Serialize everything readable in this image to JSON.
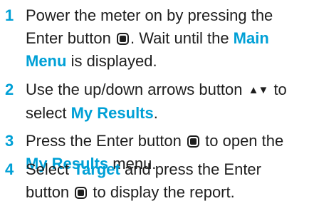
{
  "colors": {
    "accent": "#00a0d6",
    "text": "#1e1e1e"
  },
  "icons": {
    "enter": "enter-button-icon",
    "updown": "up-down-arrows-icon"
  },
  "steps": [
    {
      "number": "1",
      "t1": "Power the meter on by pressing the Enter button ",
      "t2": ". Wait until the ",
      "hl1": "Main Menu",
      "t3": " is displayed."
    },
    {
      "number": "2",
      "t1": "Use the up/down arrows button ",
      "arrows": "▲▼",
      "t2": " to select ",
      "hl1": "My Results",
      "t3": "."
    },
    {
      "number": "3",
      "t1": "Press the Enter button ",
      "t2": " to open the ",
      "hl1": "My Results",
      "t3": " menu."
    },
    {
      "number": "4",
      "t1": "Select ",
      "hl1": "Target",
      "t2": " and press the Enter button ",
      "t3": " to display the report."
    }
  ]
}
